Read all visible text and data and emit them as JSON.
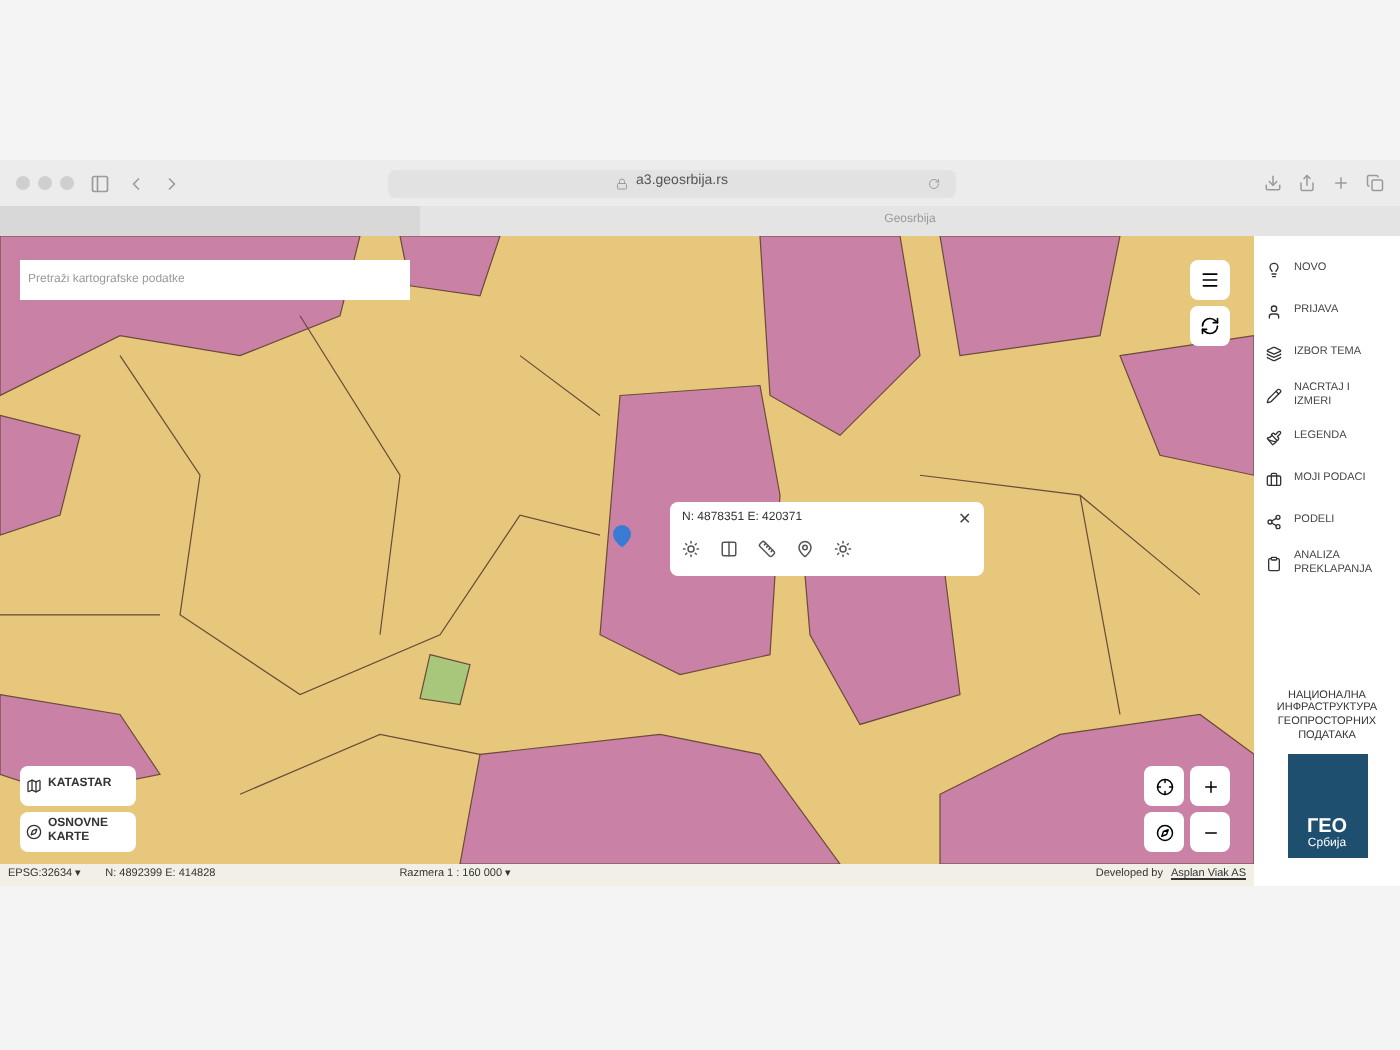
{
  "browser": {
    "url": "a3.geosrbija.rs",
    "tab": "Geosrbija"
  },
  "search": {
    "placeholder": "Pretraži kartografske podatke"
  },
  "popup": {
    "coords": "N: 4878351 E: 420371",
    "close": "✕"
  },
  "layer_buttons": [
    {
      "label": "KATASTAR",
      "kind": "cadastre"
    },
    {
      "label": "OSNOVNE KARTE",
      "kind": "basemap"
    }
  ],
  "sidebar": {
    "items": [
      {
        "label": "NOVO",
        "kind": "bulb"
      },
      {
        "label": "PRIJAVA",
        "kind": "user"
      },
      {
        "label": "IZBOR TEMA",
        "kind": "layers"
      },
      {
        "label": "NACRTAJ I IZMERI",
        "kind": "pencil"
      },
      {
        "label": "LEGENDA",
        "kind": "brush"
      },
      {
        "label": "MOJI PODACI",
        "kind": "briefcase"
      },
      {
        "label": "PODELI",
        "kind": "share"
      },
      {
        "label": "ANALIZA PREKLAPANJA",
        "kind": "clipboard"
      }
    ],
    "logo_caption": "НАЦИОНАЛНА ИНФРАСТРУКТУРА ГЕОПРОСТОРНИХ ПОДАТАКА",
    "logo_title": "ГЕО",
    "logo_subtitle": "Србија"
  },
  "status_bar": {
    "projection": "EPSG:32634 ▾",
    "cursor": "N: 4892399 E: 414828",
    "scale": "Razmera 1 : 160 000 ▾",
    "credit": "Developed by",
    "credit_link": "Asplan Viak AS"
  }
}
